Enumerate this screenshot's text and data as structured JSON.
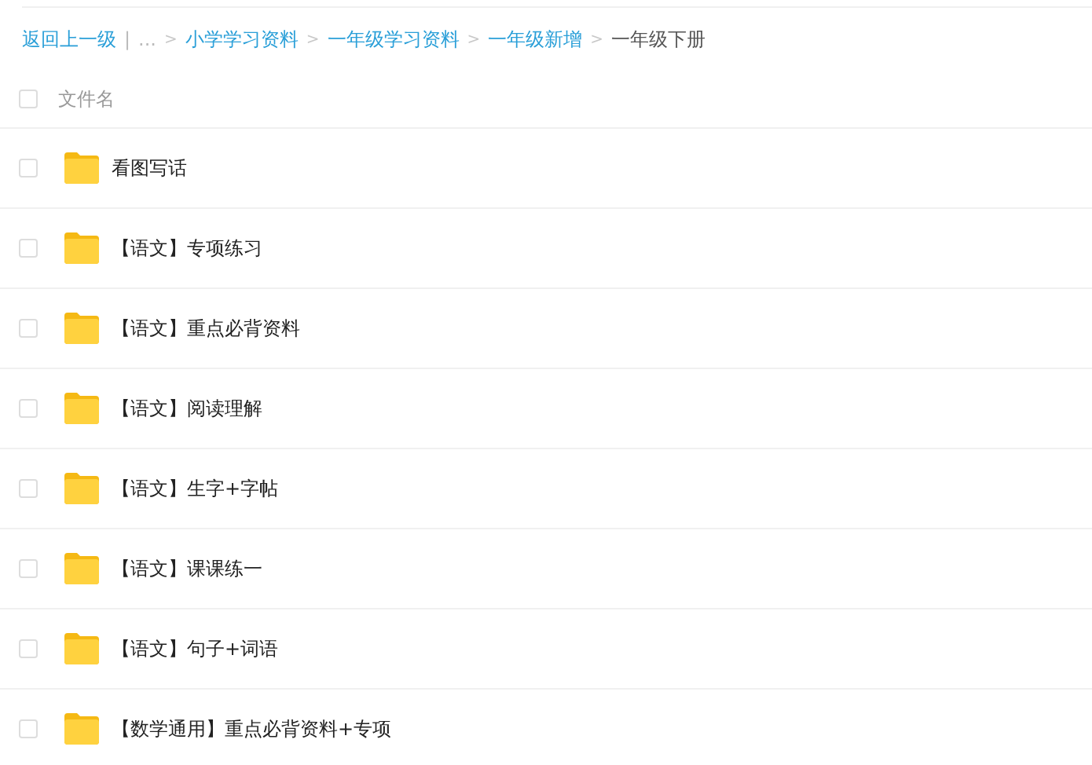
{
  "breadcrumb": {
    "back": "返回上一级",
    "divider": "|",
    "ellipsis": "...",
    "separator": ">",
    "items": [
      {
        "label": "小学学习资料",
        "current": false
      },
      {
        "label": "一年级学习资料",
        "current": false
      },
      {
        "label": "一年级新增",
        "current": false
      },
      {
        "label": "一年级下册",
        "current": true
      }
    ]
  },
  "header": {
    "label": "文件名",
    "checked": false
  },
  "rows": [
    {
      "name": "看图写话",
      "checked": false
    },
    {
      "name": "【语文】专项练习",
      "checked": false
    },
    {
      "name": "【语文】重点必背资料",
      "checked": false
    },
    {
      "name": "【语文】阅读理解",
      "checked": false
    },
    {
      "name": "【语文】生字+字帖",
      "checked": false
    },
    {
      "name": "【语文】课课练一",
      "checked": false
    },
    {
      "name": "【语文】句子+词语",
      "checked": false
    },
    {
      "name": "【数学通用】重点必背资料+专项",
      "checked": false
    }
  ]
}
